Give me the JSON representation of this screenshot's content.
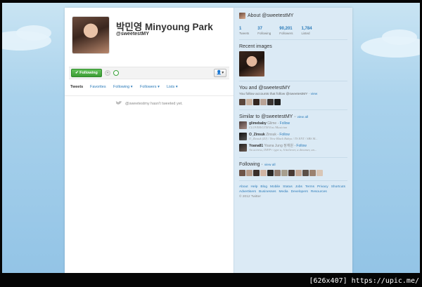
{
  "profile": {
    "full_name": "박민영 Minyoung Park",
    "handle": "@sweetestMY",
    "follow_button": "Following"
  },
  "tabs": [
    "Tweets",
    "Favorites",
    "Following",
    "Followers",
    "Lists"
  ],
  "timeline": {
    "empty_message": "@sweetestmy hasn't tweeted yet."
  },
  "about": {
    "title": "About @sweetestMY",
    "stats": [
      {
        "value": "1",
        "label": "Tweets"
      },
      {
        "value": "37",
        "label": "Following"
      },
      {
        "value": "90,201",
        "label": "Followers"
      },
      {
        "value": "1,784",
        "label": "Listed"
      }
    ]
  },
  "recent_images": {
    "title": "Recent images"
  },
  "you_and": {
    "title": "You and @sweetestMY",
    "text": "You follow accounts that follow @sweetestMY ·",
    "link": "view"
  },
  "similar": {
    "title": "Similar to @sweetestMY",
    "view_all": "view all",
    "users": [
      {
        "handle": "glimebaby",
        "name": "Glime",
        "follow": "Follow",
        "bio": "CLOVER/GTM Ent./Musician"
      },
      {
        "handle": "O_Zinsuk",
        "name": "Zinsuk",
        "follow": "Follow",
        "bio": "O_Zinsuk (ZJ) / New Black Babys / TS ENT / SBS M..."
      },
      {
        "handle": "Yoana81",
        "name": "Yoana Jung 정재원",
        "follow": "Follow",
        "bio": "An actress, INFP+ type a, A believer, a dreamer, an..."
      }
    ]
  },
  "following": {
    "title": "Following",
    "view_all": "view all"
  },
  "footer": {
    "links": [
      "About",
      "Help",
      "Blog",
      "Mobile",
      "Status",
      "Jobs",
      "Terms",
      "Privacy",
      "Shortcuts",
      "Advertisers",
      "Businesses",
      "Media",
      "Developers",
      "Resources"
    ],
    "copyright": "© 2012 Twitter"
  },
  "watermark": "[626x407] https://upic.me/",
  "colors": {
    "link": "#2b7bb9",
    "follow_green": "#3d9c35",
    "sidebar": "#dbeaf5"
  }
}
